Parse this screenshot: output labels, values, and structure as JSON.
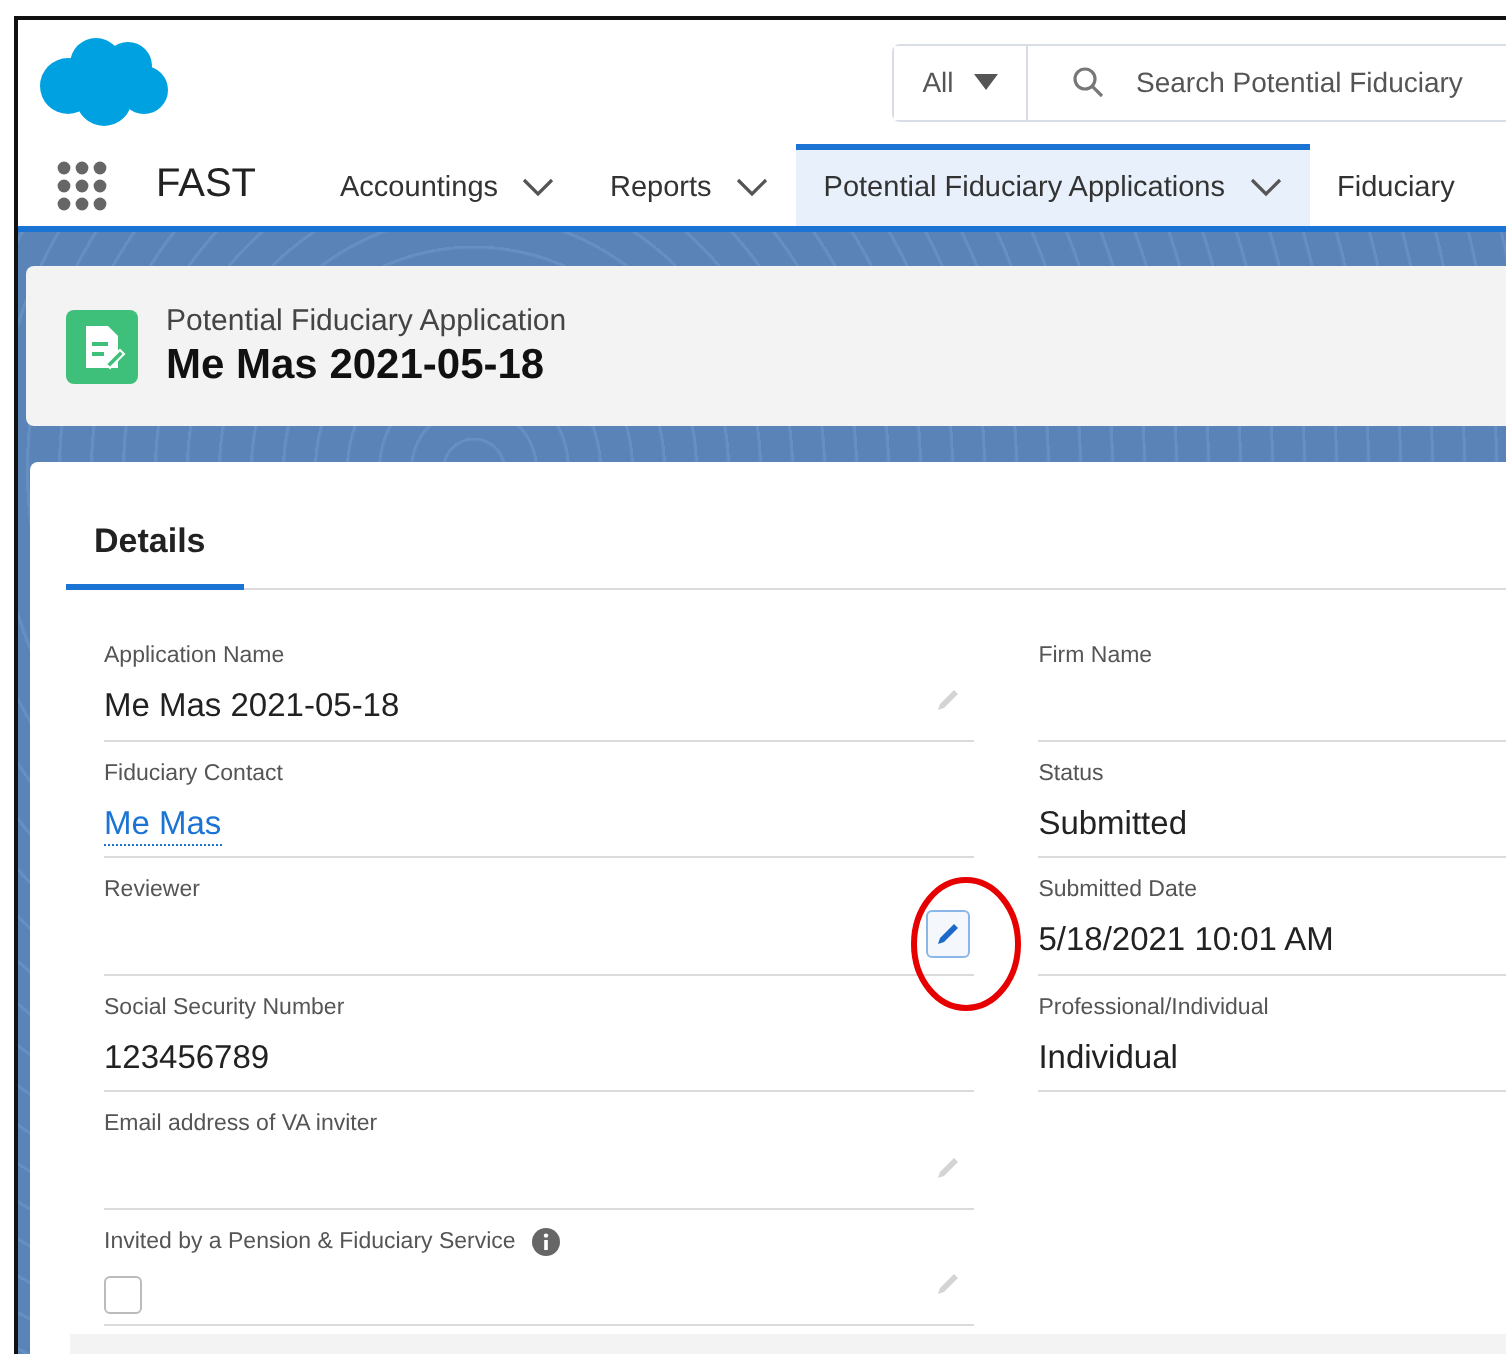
{
  "search": {
    "scope": "All",
    "placeholder": "Search Potential Fiduciary"
  },
  "app_name": "FAST",
  "nav_tabs": [
    {
      "label": "Accountings",
      "selected": false,
      "menu": true
    },
    {
      "label": "Reports",
      "selected": false,
      "menu": true
    },
    {
      "label": "Potential Fiduciary Applications",
      "selected": true,
      "menu": true
    },
    {
      "label": "Fiduciary",
      "selected": false,
      "menu": false
    }
  ],
  "record": {
    "type": "Potential Fiduciary Application",
    "title": "Me Mas 2021-05-18"
  },
  "detail_tabs": [
    {
      "label": "Details",
      "selected": true
    }
  ],
  "left_fields": [
    {
      "kind": "text",
      "label": "Application Name",
      "value": "Me Mas 2021-05-18",
      "editable": true
    },
    {
      "kind": "link",
      "label": "Fiduciary Contact",
      "value": "Me Mas",
      "editable": false
    },
    {
      "kind": "text",
      "label": "Reviewer",
      "editable": true,
      "focused": true,
      "circled": true
    },
    {
      "kind": "text",
      "label": "Social Security Number",
      "value": "123456789",
      "editable": false
    },
    {
      "kind": "text",
      "label": "Email address of VA inviter",
      "editable": true
    },
    {
      "kind": "checkbox",
      "label": "Invited by a Pension & Fiduciary Service",
      "info": true,
      "checked": false,
      "editable": true
    }
  ],
  "right_fields": [
    {
      "kind": "text",
      "label": "Firm Name",
      "editable": false
    },
    {
      "kind": "text",
      "label": "Status",
      "value": "Submitted",
      "editable": false
    },
    {
      "kind": "text",
      "label": "Submitted Date",
      "value": "5/18/2021 10:01 AM",
      "editable": false
    },
    {
      "kind": "text",
      "label": "Professional/Individual",
      "value": "Individual",
      "editable": false
    }
  ]
}
